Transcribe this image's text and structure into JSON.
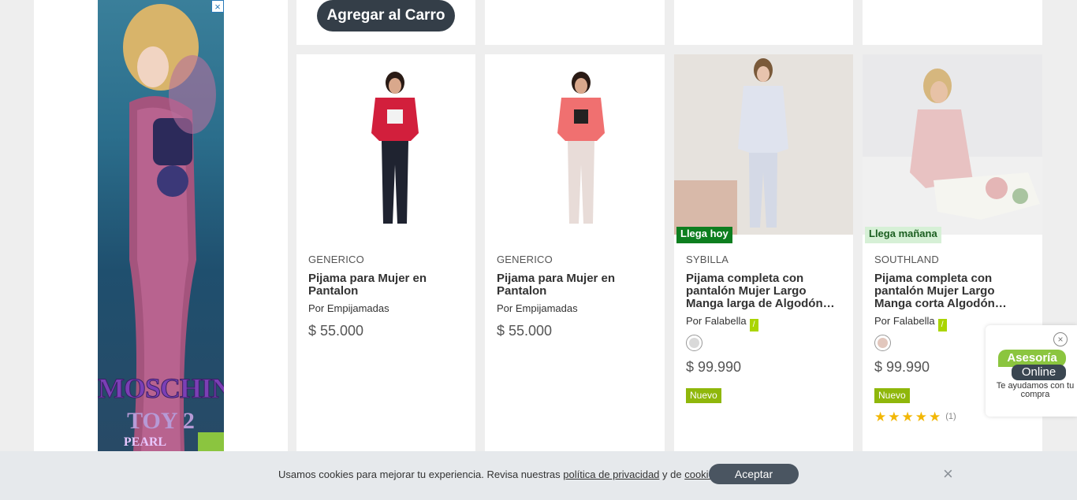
{
  "ad": {
    "close_icon": "×",
    "brand_line1": "MOSCHINO",
    "brand_line2": "TOY 2",
    "brand_line3": "PEARL"
  },
  "top_row": {
    "add_to_cart_label": "Agregar al Carro"
  },
  "products": [
    {
      "brand": "GENERICO",
      "title": "Pijama para Mujer en Pantalon",
      "seller": "Por Empijamadas",
      "price": "$ 55.000"
    },
    {
      "brand": "GENERICO",
      "title": "Pijama para Mujer en Pantalon",
      "seller": "Por Empijamadas",
      "price": "$ 55.000"
    },
    {
      "brand": "SYBILLA",
      "title": "Pijama completa con pantalón Mujer Largo Manga larga de Algodón…",
      "seller": "Por Falabella",
      "price": "$ 99.990",
      "shipping": "Llega hoy",
      "badge": "Nuevo",
      "swatch_color": "#d9d9d9"
    },
    {
      "brand": "SOUTHLAND",
      "title": "Pijama completa con pantalón Mujer Largo Manga corta Algodón…",
      "seller": "Por Falabella",
      "price": "$ 99.990",
      "shipping": "Llega mañana",
      "badge": "Nuevo",
      "swatch_color": "#e2c7bd",
      "stars": "★★★★★",
      "rating_count": "(1)"
    }
  ],
  "chat": {
    "logo_line1": "Asesoría",
    "logo_line2": "Online",
    "tagline": "Te ayudamos con tu compra"
  },
  "cookies": {
    "text_before": "Usamos cookies para mejorar tu experiencia. Revisa nuestras ",
    "privacy_link": "política de privacidad",
    "text_middle": " y de ",
    "cookies_link": "cookies",
    "text_after": ".",
    "accept_label": "Aceptar",
    "close_icon": "×"
  },
  "colors": {
    "accent_dark": "#343e48",
    "falabella_green": "#aad500",
    "ship_today": "#0d7e1f",
    "new_badge": "#8fb70b",
    "star": "#f2b705"
  }
}
